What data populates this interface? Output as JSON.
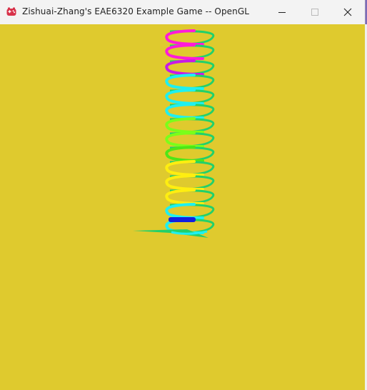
{
  "window": {
    "title": "Zishuai-Zhang's EAE6320 Example Game -- OpenGL",
    "app_icon": "game-controller-icon",
    "controls": {
      "minimize": "minimize-icon",
      "maximize": "maximize-icon",
      "close": "close-icon"
    }
  },
  "viewport": {
    "background_color": "#dfca2e",
    "scene": "rendered-3d-spiral",
    "colors": {
      "magenta": "#ff1ad9",
      "purple": "#c81ae6",
      "cyan": "#1ff0f0",
      "lime": "#7aff1a",
      "green": "#4ee616",
      "yellow": "#ffee10",
      "teal_green": "#22d06a",
      "blue": "#1020e0"
    }
  }
}
